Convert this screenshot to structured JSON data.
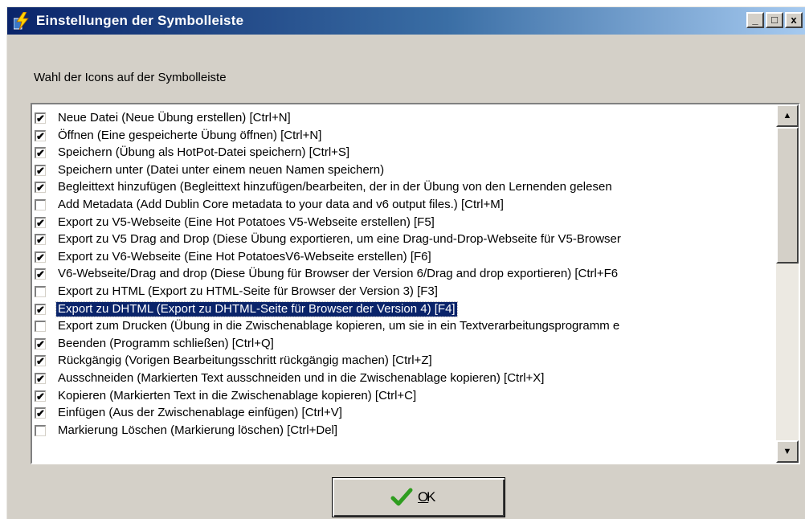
{
  "window": {
    "title": "Einstellungen der Symbolleiste",
    "controls": {
      "minimize": "_",
      "maximize": "□",
      "close": "x"
    }
  },
  "instruction": "Wahl der Icons auf der Symbolleiste",
  "list": {
    "items": [
      {
        "label": "Neue Datei (Neue Übung erstellen) [Ctrl+N]",
        "checked": true,
        "selected": false
      },
      {
        "label": "Öffnen (Eine gespeicherte Übung öffnen) [Ctrl+N]",
        "checked": true,
        "selected": false
      },
      {
        "label": "Speichern (Übung als HotPot-Datei speichern) [Ctrl+S]",
        "checked": true,
        "selected": false
      },
      {
        "label": "Speichern unter (Datei unter einem neuen Namen speichern)",
        "checked": true,
        "selected": false
      },
      {
        "label": "Begleittext hinzufügen (Begleittext hinzufügen/bearbeiten, der in der Übung von den Lernenden gelesen",
        "checked": true,
        "selected": false
      },
      {
        "label": "Add Metadata (Add Dublin Core metadata to your data and v6 output files.) [Ctrl+M]",
        "checked": false,
        "selected": false
      },
      {
        "label": "Export zu V5-Webseite (Eine Hot Potatoes V5-Webseite erstellen) [F5]",
        "checked": true,
        "selected": false
      },
      {
        "label": "Export zu V5 Drag and Drop (Diese Übung exportieren, um eine Drag-und-Drop-Webseite für V5-Browser",
        "checked": true,
        "selected": false
      },
      {
        "label": "Export zu V6-Webseite (Eine Hot PotatoesV6-Webseite erstellen) [F6]",
        "checked": true,
        "selected": false
      },
      {
        "label": "V6-Webseite/Drag and drop (Diese Übung für Browser der Version 6/Drag and drop exportieren) [Ctrl+F6",
        "checked": true,
        "selected": false
      },
      {
        "label": "Export zu HTML (Export zu HTML-Seite für Browser der Version 3) [F3]",
        "checked": false,
        "selected": false
      },
      {
        "label": "Export zu DHTML (Export zu DHTML-Seite für Browser der Version 4) [F4]",
        "checked": true,
        "selected": true
      },
      {
        "label": "Export zum Drucken (Übung in die Zwischenablage kopieren, um sie in ein Textverarbeitungsprogramm e",
        "checked": false,
        "selected": false
      },
      {
        "label": "Beenden (Programm schließen) [Ctrl+Q]",
        "checked": true,
        "selected": false
      },
      {
        "label": "Rückgängig (Vorigen Bearbeitungsschritt rückgängig machen) [Ctrl+Z]",
        "checked": true,
        "selected": false
      },
      {
        "label": "Ausschneiden (Markierten Text ausschneiden und in die Zwischenablage kopieren) [Ctrl+X]",
        "checked": true,
        "selected": false
      },
      {
        "label": "Kopieren (Markierten Text in die Zwischenablage kopieren) [Ctrl+C]",
        "checked": true,
        "selected": false
      },
      {
        "label": "Einfügen (Aus der Zwischenablage einfügen) [Ctrl+V]",
        "checked": true,
        "selected": false
      },
      {
        "label": "Markierung Löschen (Markierung löschen) [Ctrl+Del]",
        "checked": false,
        "selected": false
      }
    ],
    "scroll": {
      "up_arrow": "▲",
      "down_arrow": "▼",
      "position": 0.0
    }
  },
  "ok_button": {
    "accel": "O",
    "rest": "K"
  },
  "colors": {
    "titlebar_start": "#0a246a",
    "titlebar_end": "#a6caf0",
    "selection": "#0a246a",
    "dialog_face": "#d4d0c8",
    "check_green": "#2e9d1f"
  },
  "icons": {
    "app": "lightning-bolt-icon",
    "ok": "green-check-icon"
  }
}
